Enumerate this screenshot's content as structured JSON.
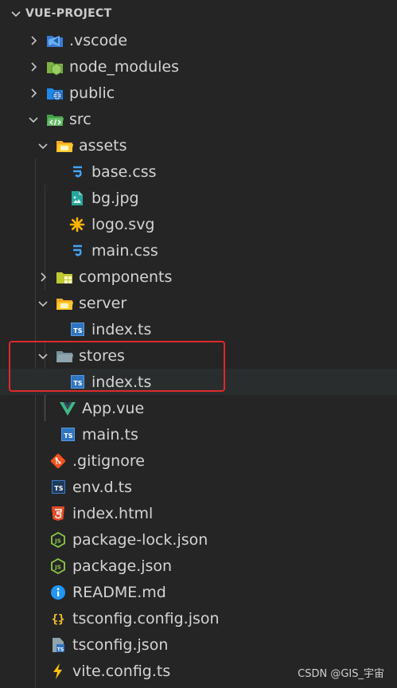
{
  "explorer": {
    "section_title": "VUE-PROJECT"
  },
  "tree": [
    {
      "label": ".vscode",
      "icon": "vscode-folder-icon",
      "kind": "folder",
      "state": "collapsed"
    },
    {
      "label": "node_modules",
      "icon": "node-folder-icon",
      "kind": "folder",
      "state": "collapsed"
    },
    {
      "label": "public",
      "icon": "public-folder-icon",
      "kind": "folder",
      "state": "collapsed"
    },
    {
      "label": "src",
      "icon": "src-folder-icon",
      "kind": "folder",
      "state": "expanded"
    },
    {
      "label": "assets",
      "icon": "assets-folder-icon",
      "kind": "folder",
      "state": "expanded"
    },
    {
      "label": "base.css",
      "icon": "css-icon",
      "kind": "file"
    },
    {
      "label": "bg.jpg",
      "icon": "image-icon",
      "kind": "file"
    },
    {
      "label": "logo.svg",
      "icon": "svg-icon",
      "kind": "file"
    },
    {
      "label": "main.css",
      "icon": "css-icon",
      "kind": "file"
    },
    {
      "label": "components",
      "icon": "components-folder-icon",
      "kind": "folder",
      "state": "collapsed"
    },
    {
      "label": "server",
      "icon": "server-folder-icon",
      "kind": "folder",
      "state": "expanded"
    },
    {
      "label": "index.ts",
      "icon": "typescript-icon",
      "kind": "file"
    },
    {
      "label": "stores",
      "icon": "folder-open-icon",
      "kind": "folder",
      "state": "expanded"
    },
    {
      "label": "index.ts",
      "icon": "typescript-icon",
      "kind": "file"
    },
    {
      "label": "App.vue",
      "icon": "vue-icon",
      "kind": "file"
    },
    {
      "label": "main.ts",
      "icon": "typescript-icon",
      "kind": "file"
    },
    {
      "label": ".gitignore",
      "icon": "git-icon",
      "kind": "file"
    },
    {
      "label": "env.d.ts",
      "icon": "typescript-def-icon",
      "kind": "file"
    },
    {
      "label": "index.html",
      "icon": "html5-icon",
      "kind": "file"
    },
    {
      "label": "package-lock.json",
      "icon": "nodejs-icon",
      "kind": "file"
    },
    {
      "label": "package.json",
      "icon": "nodejs-icon",
      "kind": "file"
    },
    {
      "label": "README.md",
      "icon": "info-icon",
      "kind": "file"
    },
    {
      "label": "tsconfig.config.json",
      "icon": "json-braces-icon",
      "kind": "file"
    },
    {
      "label": "tsconfig.json",
      "icon": "tsconfig-icon",
      "kind": "file"
    },
    {
      "label": "vite.config.ts",
      "icon": "vite-icon",
      "kind": "file"
    }
  ],
  "watermark": "CSDN @GIS_宇宙",
  "colors": {
    "background": "#252526",
    "text": "#d4d4d4",
    "highlight_border": "#e0292a",
    "typescript": "#2f74c0",
    "css": "#42a5f5",
    "vue": "#41b883",
    "git": "#f4511e",
    "html": "#e44d26",
    "node": "#8cc84b",
    "info": "#2196f3"
  }
}
